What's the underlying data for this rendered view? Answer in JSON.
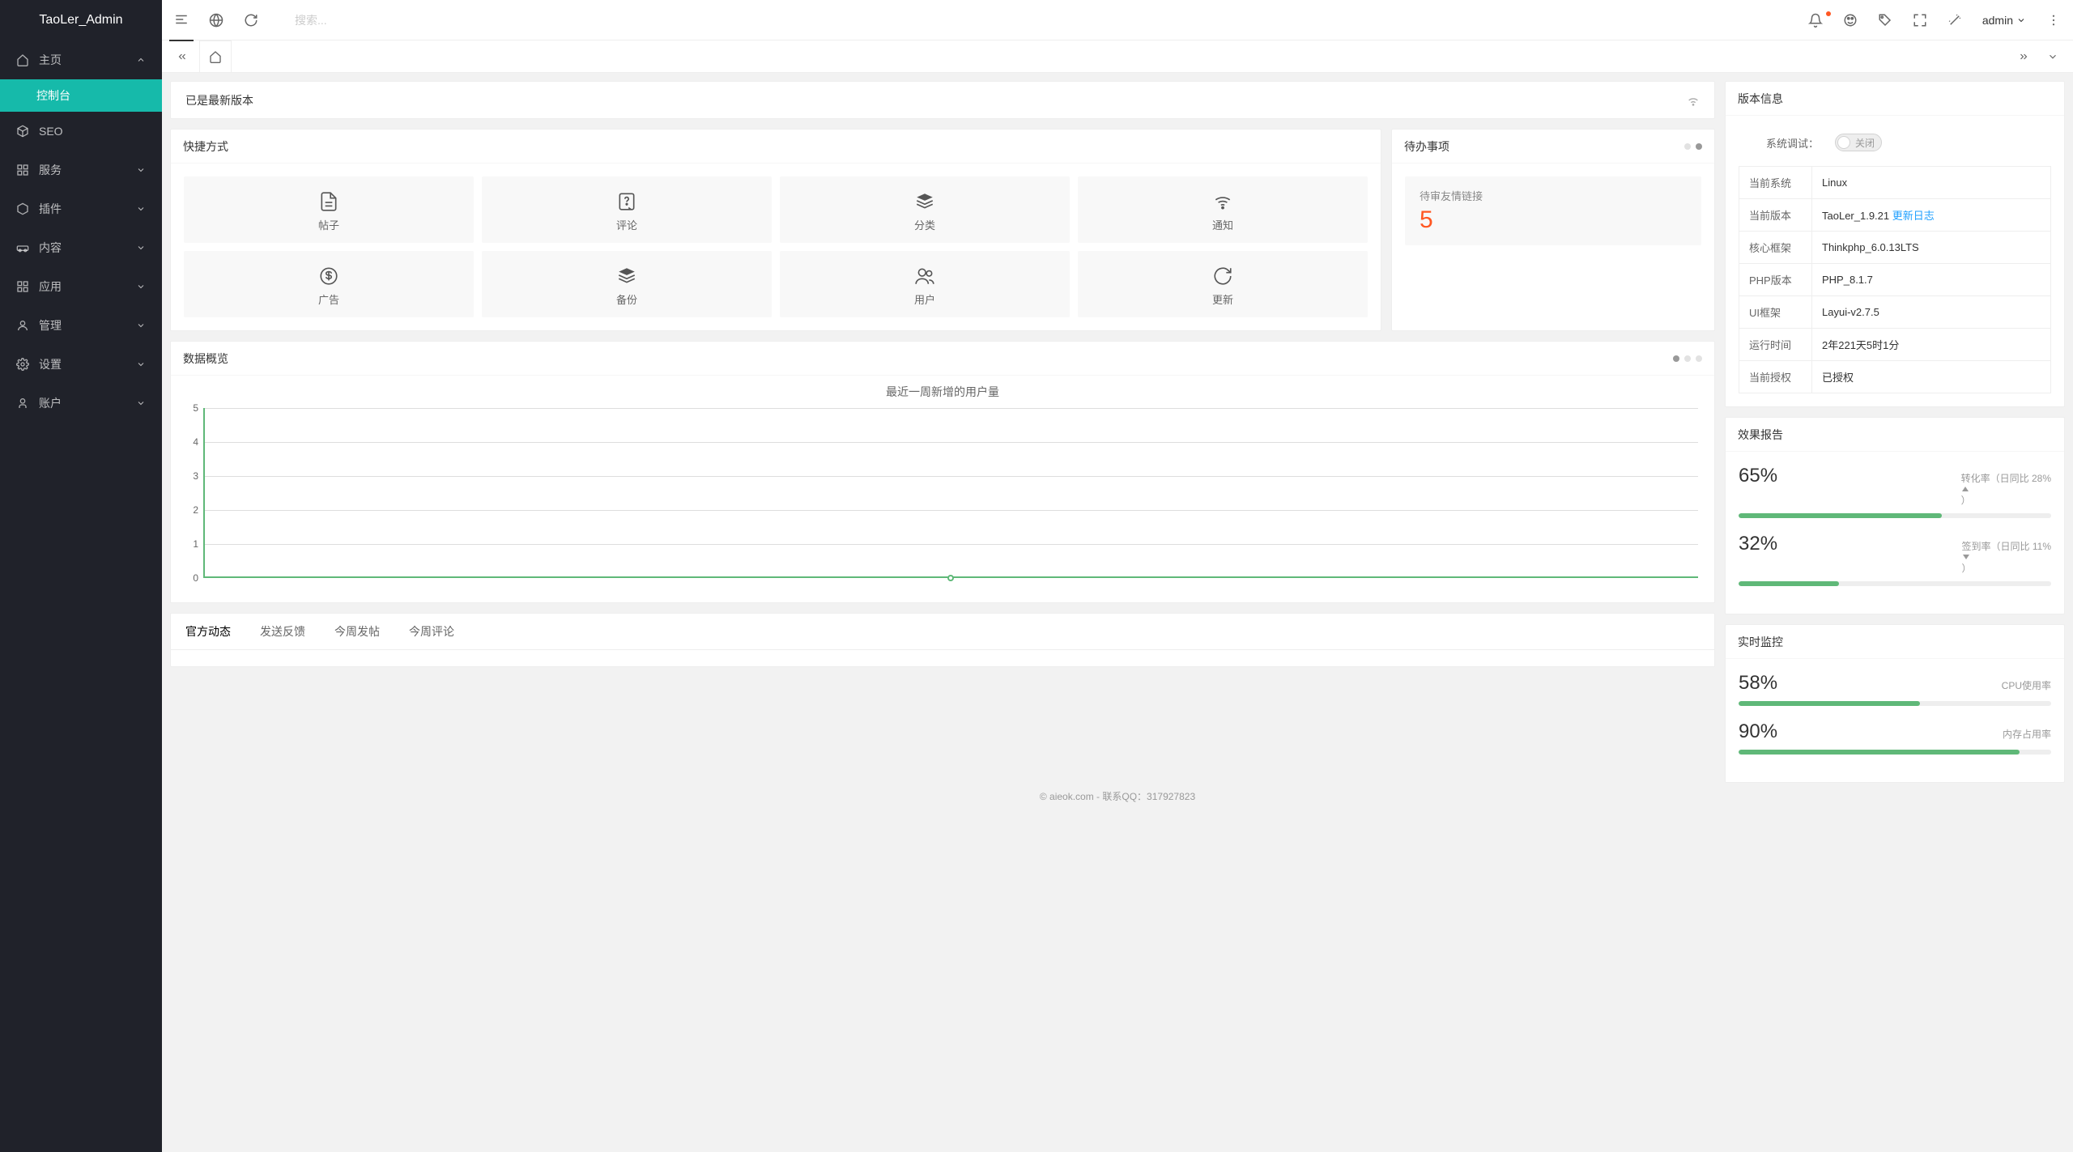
{
  "app": {
    "title": "TaoLer_Admin"
  },
  "header": {
    "search_placeholder": "搜索...",
    "username": "admin"
  },
  "sidebar": {
    "items": [
      {
        "label": "主页",
        "icon": "home",
        "expanded": true
      },
      {
        "label": "控制台",
        "child": true,
        "active": true
      },
      {
        "label": "SEO",
        "icon": "cube"
      },
      {
        "label": "服务",
        "icon": "grid",
        "expandable": true
      },
      {
        "label": "插件",
        "icon": "cube",
        "expandable": true
      },
      {
        "label": "内容",
        "icon": "car",
        "expandable": true
      },
      {
        "label": "应用",
        "icon": "apps",
        "expandable": true
      },
      {
        "label": "管理",
        "icon": "user",
        "expandable": true
      },
      {
        "label": "设置",
        "icon": "gear",
        "expandable": true
      },
      {
        "label": "账户",
        "icon": "person",
        "expandable": true
      }
    ]
  },
  "version_check": {
    "text": "已是最新版本"
  },
  "shortcuts": {
    "title": "快捷方式",
    "items": [
      {
        "label": "帖子",
        "icon": "file"
      },
      {
        "label": "评论",
        "icon": "question"
      },
      {
        "label": "分类",
        "icon": "stack"
      },
      {
        "label": "通知",
        "icon": "wifi"
      },
      {
        "label": "广告",
        "icon": "dollar"
      },
      {
        "label": "备份",
        "icon": "stack"
      },
      {
        "label": "用户",
        "icon": "users"
      },
      {
        "label": "更新",
        "icon": "refresh"
      }
    ]
  },
  "todo": {
    "title": "待办事项",
    "item_label": "待审友情链接",
    "item_value": "5"
  },
  "overview": {
    "title": "数据概览",
    "chart": {
      "title": "最近一周新增的用户量",
      "y_ticks": [
        "5",
        "4",
        "3",
        "2",
        "1",
        "0"
      ]
    }
  },
  "news_tabs": {
    "items": [
      "官方动态",
      "发送反馈",
      "今周发帖",
      "今周评论"
    ]
  },
  "version_info": {
    "title": "版本信息",
    "debug_label": "系统调试：",
    "debug_state": "关闭",
    "rows": [
      {
        "k": "当前系统",
        "v": "Linux"
      },
      {
        "k": "当前版本",
        "v": "TaoLer_1.9.21",
        "link": "更新日志"
      },
      {
        "k": "核心框架",
        "v": "Thinkphp_6.0.13LTS"
      },
      {
        "k": "PHP版本",
        "v": "PHP_8.1.7"
      },
      {
        "k": "UI框架",
        "v": "Layui-v2.7.5"
      },
      {
        "k": "运行时间",
        "v": "2年221天5时1分"
      },
      {
        "k": "当前授权",
        "v": "已授权"
      }
    ]
  },
  "report": {
    "title": "效果报告",
    "items": [
      {
        "pct": "65%",
        "meta": "转化率（日同比 28% ",
        "trend": "up",
        "suffix": "）",
        "fill": 65
      },
      {
        "pct": "32%",
        "meta": "签到率（日同比 11% ",
        "trend": "down",
        "suffix": "）",
        "fill": 32
      }
    ]
  },
  "monitor": {
    "title": "实时监控",
    "items": [
      {
        "pct": "58%",
        "meta": "CPU使用率",
        "fill": 58
      },
      {
        "pct": "90%",
        "meta": "内存占用率",
        "fill": 90
      }
    ]
  },
  "footer": {
    "text": "© aieok.com - 联系QQ：317927823"
  },
  "chart_data": {
    "type": "line",
    "title": "最近一周新增的用户量",
    "x_categories_note": "7 unlabeled days",
    "values": [
      0,
      0,
      0,
      0,
      0,
      0,
      0
    ],
    "ylim": [
      0,
      5
    ],
    "ylabel": "",
    "xlabel": ""
  }
}
